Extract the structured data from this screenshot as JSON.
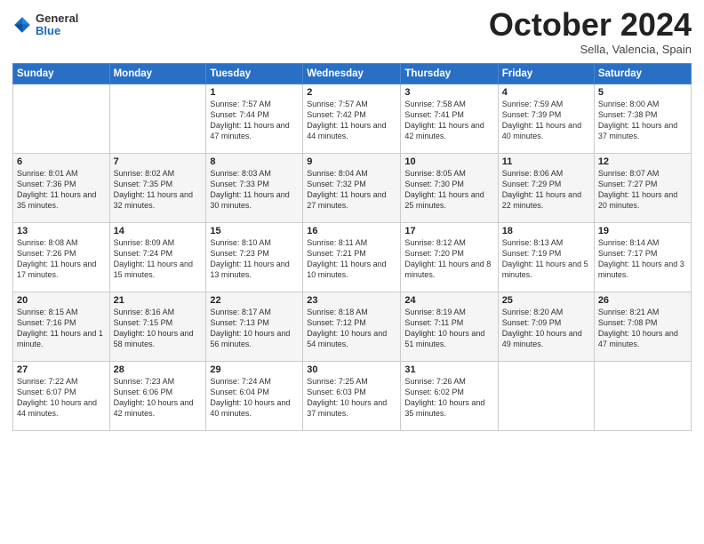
{
  "header": {
    "logo_general": "General",
    "logo_blue": "Blue",
    "month_title": "October 2024",
    "location": "Sella, Valencia, Spain"
  },
  "weekdays": [
    "Sunday",
    "Monday",
    "Tuesday",
    "Wednesday",
    "Thursday",
    "Friday",
    "Saturday"
  ],
  "weeks": [
    [
      {
        "day": "",
        "info": ""
      },
      {
        "day": "",
        "info": ""
      },
      {
        "day": "1",
        "info": "Sunrise: 7:57 AM\nSunset: 7:44 PM\nDaylight: 11 hours and 47 minutes."
      },
      {
        "day": "2",
        "info": "Sunrise: 7:57 AM\nSunset: 7:42 PM\nDaylight: 11 hours and 44 minutes."
      },
      {
        "day": "3",
        "info": "Sunrise: 7:58 AM\nSunset: 7:41 PM\nDaylight: 11 hours and 42 minutes."
      },
      {
        "day": "4",
        "info": "Sunrise: 7:59 AM\nSunset: 7:39 PM\nDaylight: 11 hours and 40 minutes."
      },
      {
        "day": "5",
        "info": "Sunrise: 8:00 AM\nSunset: 7:38 PM\nDaylight: 11 hours and 37 minutes."
      }
    ],
    [
      {
        "day": "6",
        "info": "Sunrise: 8:01 AM\nSunset: 7:36 PM\nDaylight: 11 hours and 35 minutes."
      },
      {
        "day": "7",
        "info": "Sunrise: 8:02 AM\nSunset: 7:35 PM\nDaylight: 11 hours and 32 minutes."
      },
      {
        "day": "8",
        "info": "Sunrise: 8:03 AM\nSunset: 7:33 PM\nDaylight: 11 hours and 30 minutes."
      },
      {
        "day": "9",
        "info": "Sunrise: 8:04 AM\nSunset: 7:32 PM\nDaylight: 11 hours and 27 minutes."
      },
      {
        "day": "10",
        "info": "Sunrise: 8:05 AM\nSunset: 7:30 PM\nDaylight: 11 hours and 25 minutes."
      },
      {
        "day": "11",
        "info": "Sunrise: 8:06 AM\nSunset: 7:29 PM\nDaylight: 11 hours and 22 minutes."
      },
      {
        "day": "12",
        "info": "Sunrise: 8:07 AM\nSunset: 7:27 PM\nDaylight: 11 hours and 20 minutes."
      }
    ],
    [
      {
        "day": "13",
        "info": "Sunrise: 8:08 AM\nSunset: 7:26 PM\nDaylight: 11 hours and 17 minutes."
      },
      {
        "day": "14",
        "info": "Sunrise: 8:09 AM\nSunset: 7:24 PM\nDaylight: 11 hours and 15 minutes."
      },
      {
        "day": "15",
        "info": "Sunrise: 8:10 AM\nSunset: 7:23 PM\nDaylight: 11 hours and 13 minutes."
      },
      {
        "day": "16",
        "info": "Sunrise: 8:11 AM\nSunset: 7:21 PM\nDaylight: 11 hours and 10 minutes."
      },
      {
        "day": "17",
        "info": "Sunrise: 8:12 AM\nSunset: 7:20 PM\nDaylight: 11 hours and 8 minutes."
      },
      {
        "day": "18",
        "info": "Sunrise: 8:13 AM\nSunset: 7:19 PM\nDaylight: 11 hours and 5 minutes."
      },
      {
        "day": "19",
        "info": "Sunrise: 8:14 AM\nSunset: 7:17 PM\nDaylight: 11 hours and 3 minutes."
      }
    ],
    [
      {
        "day": "20",
        "info": "Sunrise: 8:15 AM\nSunset: 7:16 PM\nDaylight: 11 hours and 1 minute."
      },
      {
        "day": "21",
        "info": "Sunrise: 8:16 AM\nSunset: 7:15 PM\nDaylight: 10 hours and 58 minutes."
      },
      {
        "day": "22",
        "info": "Sunrise: 8:17 AM\nSunset: 7:13 PM\nDaylight: 10 hours and 56 minutes."
      },
      {
        "day": "23",
        "info": "Sunrise: 8:18 AM\nSunset: 7:12 PM\nDaylight: 10 hours and 54 minutes."
      },
      {
        "day": "24",
        "info": "Sunrise: 8:19 AM\nSunset: 7:11 PM\nDaylight: 10 hours and 51 minutes."
      },
      {
        "day": "25",
        "info": "Sunrise: 8:20 AM\nSunset: 7:09 PM\nDaylight: 10 hours and 49 minutes."
      },
      {
        "day": "26",
        "info": "Sunrise: 8:21 AM\nSunset: 7:08 PM\nDaylight: 10 hours and 47 minutes."
      }
    ],
    [
      {
        "day": "27",
        "info": "Sunrise: 7:22 AM\nSunset: 6:07 PM\nDaylight: 10 hours and 44 minutes."
      },
      {
        "day": "28",
        "info": "Sunrise: 7:23 AM\nSunset: 6:06 PM\nDaylight: 10 hours and 42 minutes."
      },
      {
        "day": "29",
        "info": "Sunrise: 7:24 AM\nSunset: 6:04 PM\nDaylight: 10 hours and 40 minutes."
      },
      {
        "day": "30",
        "info": "Sunrise: 7:25 AM\nSunset: 6:03 PM\nDaylight: 10 hours and 37 minutes."
      },
      {
        "day": "31",
        "info": "Sunrise: 7:26 AM\nSunset: 6:02 PM\nDaylight: 10 hours and 35 minutes."
      },
      {
        "day": "",
        "info": ""
      },
      {
        "day": "",
        "info": ""
      }
    ]
  ]
}
